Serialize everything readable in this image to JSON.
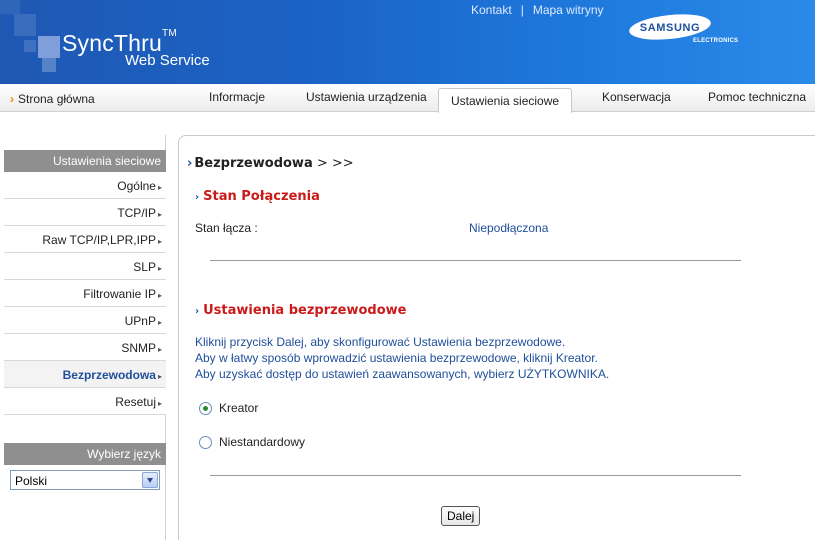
{
  "header": {
    "logo_main": "SyncThru",
    "logo_tm": "TM",
    "logo_sub": "Web Service",
    "links": {
      "contact": "Kontakt",
      "separator": "|",
      "sitemap": "Mapa witryny"
    },
    "brand": {
      "name": "SAMSUNG",
      "sub": "ELECTRONICS",
      "color": "#1c4f9c"
    }
  },
  "nav": {
    "home": "Strona główna",
    "tabs": [
      {
        "label": "Informacje"
      },
      {
        "label": "Ustawienia urządzenia"
      },
      {
        "label": "Ustawienia sieciowe",
        "active": true
      },
      {
        "label": "Konserwacja"
      },
      {
        "label": "Pomoc techniczna"
      }
    ]
  },
  "sidebar": {
    "title": "Ustawienia sieciowe",
    "items": [
      {
        "label": "Ogólne"
      },
      {
        "label": "TCP/IP"
      },
      {
        "label": "Raw TCP/IP,LPR,IPP"
      },
      {
        "label": "SLP"
      },
      {
        "label": "Filtrowanie IP"
      },
      {
        "label": "UPnP"
      },
      {
        "label": "SNMP"
      },
      {
        "label": "Bezprzewodowa",
        "active": true
      },
      {
        "label": "Resetuj"
      }
    ],
    "language": {
      "title": "Wybierz język",
      "selected": "Polski"
    }
  },
  "main": {
    "breadcrumb": {
      "current": "Bezprzewodowa",
      "rest": " > >>"
    },
    "connection": {
      "title": "Stan Połączenia",
      "label": "Stan łącza :",
      "value": "Niepodłączona"
    },
    "wireless": {
      "title": "Ustawienia bezprzewodowe",
      "lines": [
        "Kliknij przycisk Dalej, aby skonfigurować Ustawienia bezprzewodowe.",
        "Aby w łatwy sposób wprowadzić ustawienia bezprzewodowe, kliknij Kreator.",
        "Aby uzyskać dostęp do ustawień zaawansowanych, wybierz UŻYTKOWNIKA."
      ],
      "options": [
        {
          "label": "Kreator",
          "checked": true
        },
        {
          "label": "Niestandardowy",
          "checked": false
        }
      ]
    },
    "next_button": "Dalej"
  },
  "colors": {
    "header_blue": "#1b63c6",
    "link_blue": "#1f4e9a",
    "section_red": "#cc1a1a",
    "sidebar_grey": "#8f8f8f"
  }
}
